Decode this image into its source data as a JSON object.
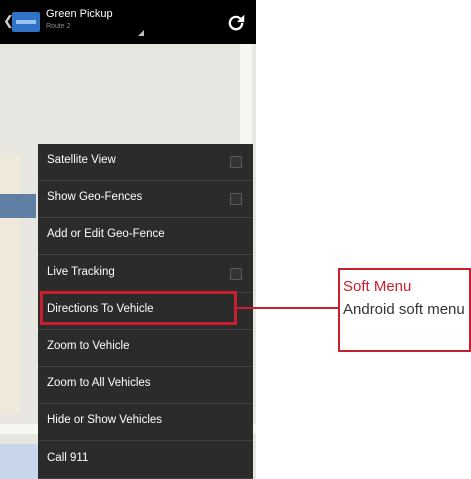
{
  "app_bar": {
    "title": "Green Pickup",
    "subtitle": "Route 2",
    "refresh_icon": "refresh-icon",
    "back_icon": "chevron-left-icon"
  },
  "menu": {
    "items": [
      {
        "label": "Satellite View",
        "has_checkbox": true
      },
      {
        "label": "Show Geo-Fences",
        "has_checkbox": true
      },
      {
        "label": "Add or Edit Geo-Fence",
        "has_checkbox": false
      },
      {
        "label": "Live Tracking",
        "has_checkbox": true
      },
      {
        "label": "Directions To Vehicle",
        "has_checkbox": false
      },
      {
        "label": "Zoom to Vehicle",
        "has_checkbox": false
      },
      {
        "label": "Zoom to All Vehicles",
        "has_checkbox": false
      },
      {
        "label": "Hide or Show Vehicles",
        "has_checkbox": false
      },
      {
        "label": "Call 911",
        "has_checkbox": false
      }
    ],
    "highlighted_item": "Directions To Vehicle"
  },
  "callout": {
    "title": "Soft Menu",
    "description": "Android soft menu"
  },
  "colors": {
    "accent_red": "#c8202f",
    "menu_bg": "#2b2b2b",
    "actionbar_bg": "#000000",
    "app_icon_blue": "#2f72c8"
  }
}
